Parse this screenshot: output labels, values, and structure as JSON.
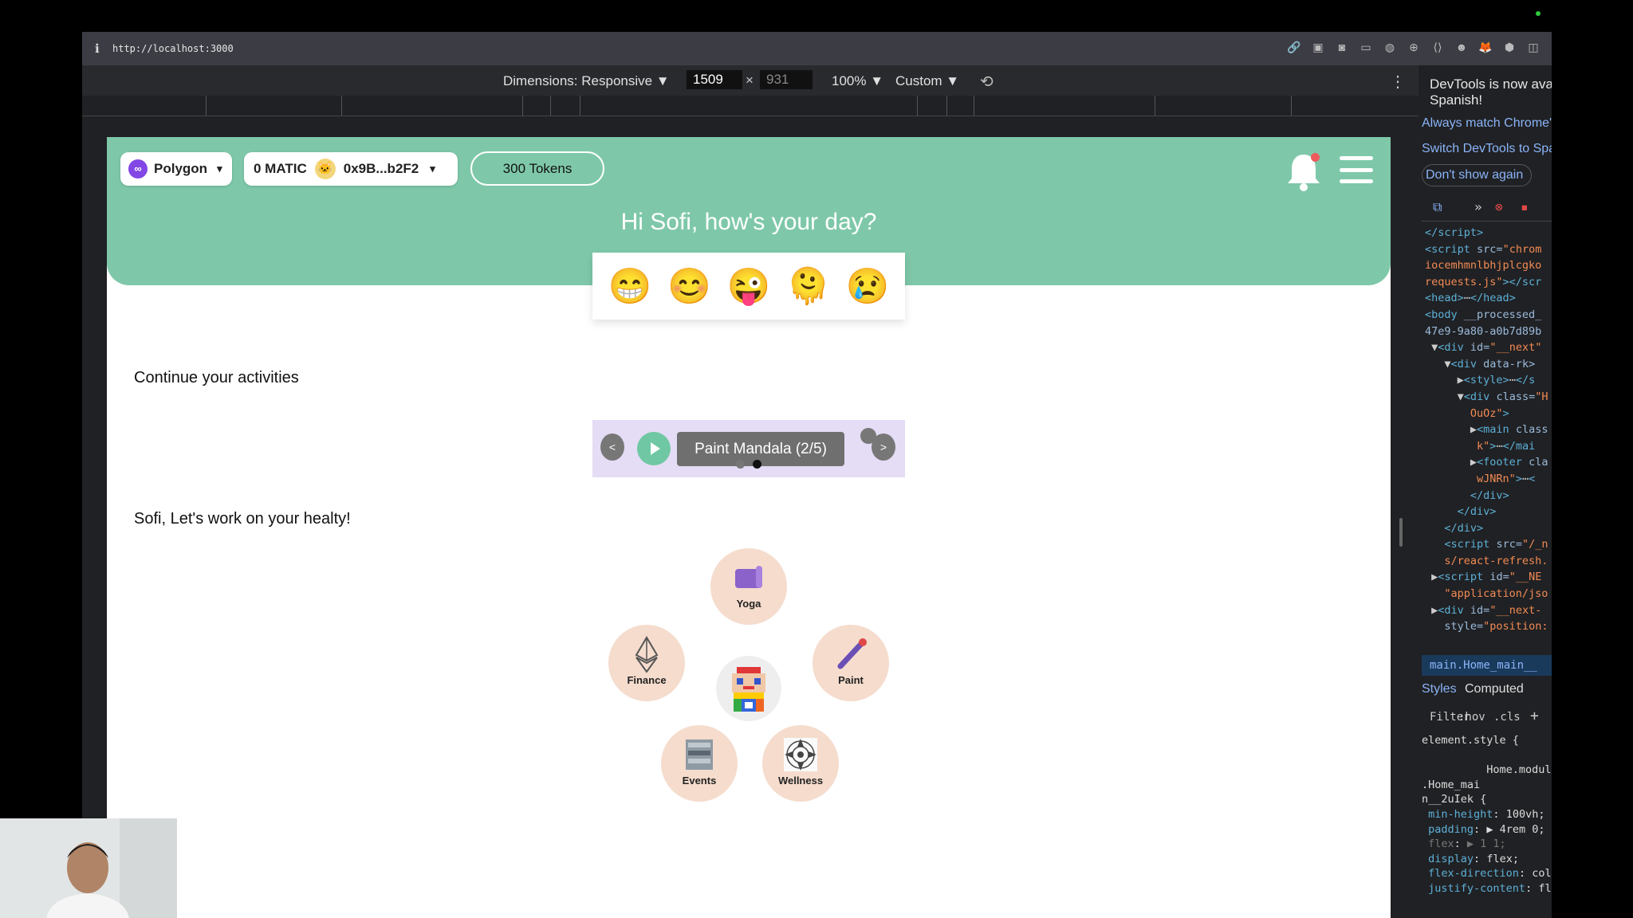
{
  "browser": {
    "url": "http://localhost:3000"
  },
  "devbar": {
    "dimensions_label": "Dimensions: Responsive ▼",
    "width": "1509",
    "times": "×",
    "height": "931",
    "zoom": "100% ▼",
    "device": "Custom ▼",
    "more": "⋮"
  },
  "header": {
    "network_label": "Polygon",
    "balance_label": "0 MATIC",
    "wallet_address": "0x9B...b2F2",
    "tokens_label": "300 Tokens",
    "greeting": "Hi Sofi, how's your day?"
  },
  "moods": [
    "😁",
    "😊",
    "😜",
    "🫠",
    "😢"
  ],
  "activities": {
    "section_title": "Continue your activities",
    "prev_label": "<",
    "next_label": ">",
    "current_label": "Paint Mandala (2/5)"
  },
  "health": {
    "section_title": "Sofi, Let's work on your healty!",
    "items": [
      {
        "label": "Yoga",
        "icon": "yoga-mat-icon"
      },
      {
        "label": "Finance",
        "icon": "ethereum-icon"
      },
      {
        "label": "Paint",
        "icon": "paintbrush-icon"
      },
      {
        "label": "Events",
        "icon": "events-photo-icon"
      },
      {
        "label": "Wellness",
        "icon": "mandala-icon"
      }
    ]
  },
  "devtools": {
    "notice_line1": "DevTools is now available in",
    "notice_line2": "Spanish!",
    "link1": "Always match Chrome's language",
    "link2": "Switch DevTools to Spanish",
    "dont_show": "Don't show again",
    "selected_node": "main.Home_main__",
    "styles_tab": "Styles",
    "computed_tab": "Computed",
    "filter_placeholder": "Filter",
    "hov": ":hov",
    "cls": ".cls",
    "element_style": "element.style {",
    "source_file": "Home.module",
    "selector_line1": ".Home_mai",
    "selector_line2": "n__2uIek {",
    "rules": [
      {
        "prop": "min-height",
        "val": "100vh;"
      },
      {
        "prop": "padding",
        "val": "▶ 4rem 0;"
      },
      {
        "prop": "flex",
        "val": "▶ 1 1;"
      },
      {
        "prop": "display",
        "val": "flex;"
      },
      {
        "prop": "flex-direction",
        "val": "column;"
      },
      {
        "prop": "justify-content",
        "val": "flex-start;"
      }
    ]
  }
}
